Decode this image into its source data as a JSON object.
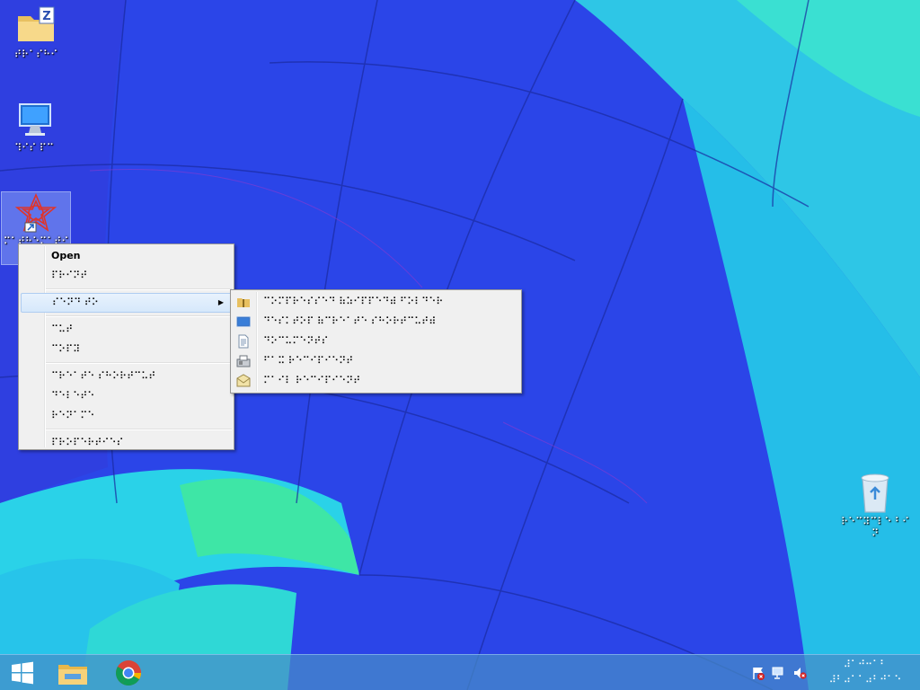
{
  "desktop": {
    "icons": [
      {
        "label": "⠞⠗⠁⠎⠓⠊"
      },
      {
        "label": "⠹⠊⠎ ⠏⠉"
      },
      {
        "label": "⠍⠁⠞⠓⠑⠍⠁⠞⠊⠉⠁"
      },
      {
        "label": "⠗⠑⠉⠽⠉⠇⠑ ⠃⠊⠝"
      }
    ]
  },
  "context_menu": {
    "items": [
      {
        "label": "Open"
      },
      {
        "label": "⠏⠗⠊⠝⠞"
      },
      {
        "label": "⠎⠑⠝⠙ ⠞⠕"
      },
      {
        "label": "⠉⠥⠞"
      },
      {
        "label": "⠉⠕⠏⠽"
      },
      {
        "label": "⠉⠗⠑⠁⠞⠑ ⠎⠓⠕⠗⠞⠉⠥⠞"
      },
      {
        "label": "⠙⠑⠇⠑⠞⠑"
      },
      {
        "label": "⠗⠑⠝⠁⠍⠑"
      },
      {
        "label": "⠏⠗⠕⠏⠑⠗⠞⠊⠑⠎"
      }
    ]
  },
  "submenu": {
    "items": [
      {
        "label": "⠉⠕⠍⠏⠗⠑⠎⠎⠑⠙ ⠷⠵⠊⠏⠏⠑⠙⠾ ⠋⠕⠇⠙⠑⠗"
      },
      {
        "label": "⠙⠑⠎⠅⠞⠕⠏ ⠷⠉⠗⠑⠁⠞⠑ ⠎⠓⠕⠗⠞⠉⠥⠞⠾"
      },
      {
        "label": "⠙⠕⠉⠥⠍⠑⠝⠞⠎"
      },
      {
        "label": "⠋⠁⠭ ⠗⠑⠉⠊⠏⠊⠑⠝⠞"
      },
      {
        "label": "⠍⠁⠊⠇ ⠗⠑⠉⠊⠏⠊⠑⠝⠞"
      }
    ]
  },
  "taskbar": {
    "clock_time": "⠼⠁⠚⠒⠁⠃",
    "clock_date": "⠼⠃⠴⠁⠁⠴⠃⠚⠁⠑"
  },
  "colors": {
    "menu_highlight": "#d6e8fb",
    "menu_background": "#f0f0f0",
    "taskbar": "#468cc8"
  }
}
